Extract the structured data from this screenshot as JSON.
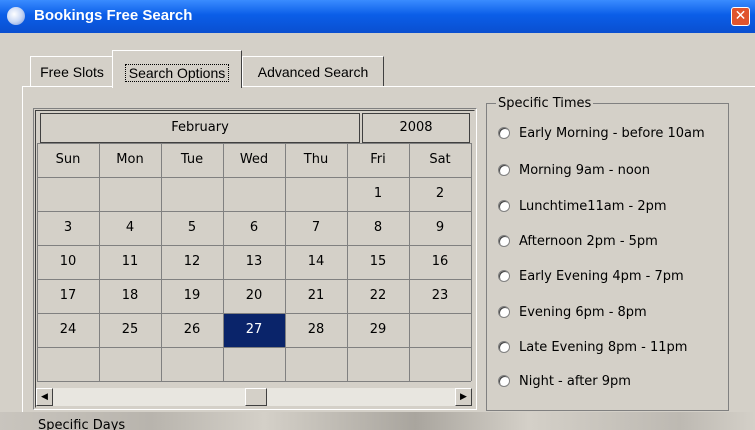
{
  "window": {
    "title": "Bookings Free Search",
    "close_glyph": "✕"
  },
  "tabs": [
    {
      "label": "Free Slots",
      "active": false
    },
    {
      "label": "Search Options",
      "active": true
    },
    {
      "label": "Advanced Search",
      "active": false
    }
  ],
  "calendar": {
    "month": "February",
    "year": "2008",
    "weekdays": [
      "Sun",
      "Mon",
      "Tue",
      "Wed",
      "Thu",
      "Fri",
      "Sat"
    ],
    "weeks": [
      [
        "",
        "",
        "",
        "",
        "",
        "1",
        "2"
      ],
      [
        "3",
        "4",
        "5",
        "6",
        "7",
        "8",
        "9"
      ],
      [
        "10",
        "11",
        "12",
        "13",
        "14",
        "15",
        "16"
      ],
      [
        "17",
        "18",
        "19",
        "20",
        "21",
        "22",
        "23"
      ],
      [
        "24",
        "25",
        "26",
        "27",
        "28",
        "29",
        ""
      ],
      [
        "",
        "",
        "",
        "",
        "",
        "",
        ""
      ]
    ],
    "selected_day": "27",
    "selected_color": "#0a246a"
  },
  "specific_times": {
    "legend": "Specific Times",
    "options": [
      "Early Morning - before 10am",
      "Morning 9am - noon",
      "Lunchtime11am - 2pm",
      "Afternoon 2pm - 5pm",
      "Early Evening 4pm - 7pm",
      "Evening 6pm - 8pm",
      "Late Evening 8pm - 11pm",
      "Night - after 9pm"
    ]
  },
  "specific_days": {
    "legend": "Specific Days"
  },
  "colors": {
    "titlebar": "#0b5ee8",
    "face": "#d4d0c8"
  },
  "icons": {
    "app": "app-icon",
    "close": "close-icon",
    "scroll_left": "scroll-left-icon",
    "scroll_right": "scroll-right-icon"
  }
}
